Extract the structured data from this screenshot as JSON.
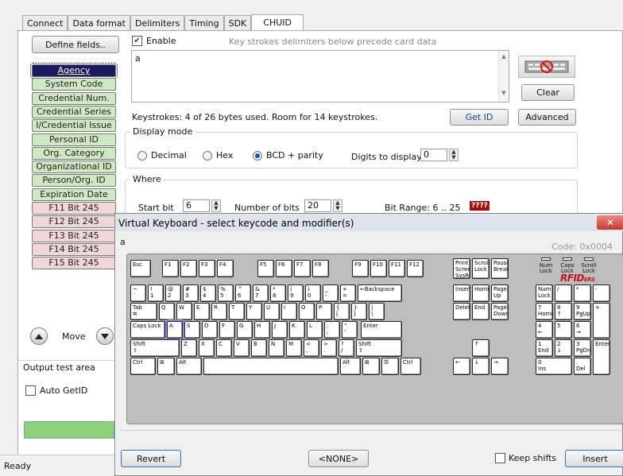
{
  "tabs": [
    {
      "label": "Connect"
    },
    {
      "label": "Data format"
    },
    {
      "label": "Delimiters"
    },
    {
      "label": "Timing"
    },
    {
      "label": "SDK"
    },
    {
      "label": "CHUID"
    }
  ],
  "left": {
    "define_fields": "Define fields..",
    "fields": [
      {
        "label": "Agency",
        "color": "#1a1a5e",
        "style": "blue"
      },
      {
        "label": "System Code",
        "style": "green"
      },
      {
        "label": "Credential Num.",
        "style": "green"
      },
      {
        "label": "Credential Series",
        "style": "green"
      },
      {
        "label": "I/Credential Issue",
        "style": "green"
      },
      {
        "label": "Personal ID",
        "style": "green"
      },
      {
        "label": "Org. Category",
        "style": "green"
      },
      {
        "label": "Organizational ID",
        "style": "green"
      },
      {
        "label": "Person/Org. ID",
        "style": "green"
      },
      {
        "label": "Expiration Date",
        "style": "green"
      },
      {
        "label": "F11 Bit 245",
        "style": "pink"
      },
      {
        "label": "F12 Bit 245",
        "style": "pink"
      },
      {
        "label": "F13 Bit 245",
        "style": "pink"
      },
      {
        "label": "F14 Bit 245",
        "style": "pink"
      },
      {
        "label": "F15 Bit 245",
        "style": "pink"
      }
    ],
    "move": "Move",
    "output_test_area": "Output test area",
    "auto_getid": "Auto GetID"
  },
  "main": {
    "enable": "Enable",
    "hint": "Key strokes delimiters below precede card data",
    "textarea_value": "a",
    "clear": "Clear",
    "keystrokes_info": "Keystrokes: 4 of 26 bytes used. Room for 14 keystrokes.",
    "get_id": "Get ID",
    "advanced": "Advanced",
    "display_mode": "Display mode",
    "radio_decimal": "Decimal",
    "radio_hex": "Hex",
    "radio_bcd": "BCD + parity",
    "digits_to_display": "Digits to display",
    "digits_value": "0",
    "where": "Where",
    "start_bit": "Start bit",
    "start_bit_value": "6",
    "number_of_bits": "Number of bits",
    "number_of_bits_value": "20",
    "bit_range": "Bit Range: 6 .. 25",
    "bit_badge": "????"
  },
  "status": "Ready",
  "vk": {
    "title": "Virtual Keyboard - select keycode and modifier(s)",
    "typed": "a",
    "code": "Code: 0x0004",
    "brand_big": "RFID",
    "brand_small": "ERS",
    "leds": [
      "Num\nLock",
      "Caps\nLock",
      "Scroll\nLock"
    ],
    "revert": "Revert",
    "none": "<NONE>",
    "keep_shifts": "Keep shifts",
    "insert": "Insert",
    "keys": {
      "esc": "Esc",
      "f": [
        "F1",
        "F2",
        "F3",
        "F4",
        "F5",
        "F6",
        "F7",
        "F8",
        "F9",
        "F10",
        "F11",
        "F12"
      ],
      "print": "Print\nScreen\nSysRq",
      "scroll": "Scroll\nLock",
      "pause": "Pause\nBreak",
      "num_row": [
        "~\n`",
        "!\n1",
        "@\n2",
        "#\n3",
        "$\n4",
        "%\n5",
        "^\n6",
        "&\n7",
        "*\n8",
        "(\n9",
        ")\n0",
        "_\n-",
        "+\n="
      ],
      "backspace": "←Backspace",
      "tab": "Tab\n⭾",
      "q_row": [
        "Q",
        "W",
        "E",
        "R",
        "T",
        "Y",
        "U",
        "I",
        "O",
        "P",
        "{\n[",
        "}\n]",
        "|\n\\"
      ],
      "caps": "Caps Lock",
      "a_row": [
        "A",
        "S",
        "D",
        "F",
        "G",
        "H",
        "J",
        "K",
        "L",
        ":\n;",
        "\"\n'"
      ],
      "enter": "Enter",
      "shift": "Shift\n⇧",
      "z_row": [
        "Z",
        "X",
        "C",
        "V",
        "B",
        "N",
        "M",
        "<\n,",
        ">\n.",
        "?\n/"
      ],
      "ctrl": "Ctrl",
      "win": "⊞",
      "alt": "Alt",
      "altgr": "Alt",
      "menu": "☰",
      "insert": "Insert",
      "home": "Home",
      "pgup": "Page\nUp",
      "delete": "Delete",
      "end": "End",
      "pgdn": "Page\nDown",
      "arrow_up": "↑",
      "arrow_left": "←",
      "arrow_down": "↓",
      "arrow_right": "→",
      "numlock": "Num\nLock",
      "np_div": "/",
      "np_mul": "*",
      "np_minus": "-",
      "np7": "7\nHome",
      "np8": "8\n↑",
      "np9": "9\nPgUp",
      "np_plus": "+",
      "np4": "4\n←",
      "np5": "5",
      "np6": "6\n→",
      "np1": "1\nEnd",
      "np2": "2\n↓",
      "np3": "3\nPgDn",
      "np_enter": "Enter",
      "np0": "0\nIns",
      "np_dot": ".\nDel"
    }
  }
}
